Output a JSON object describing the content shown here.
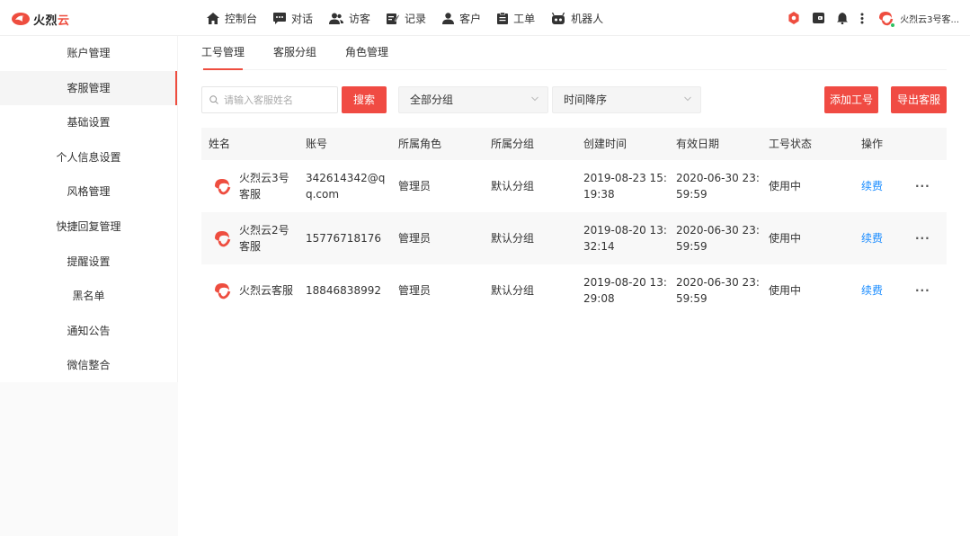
{
  "brand": {
    "name_a": "火烈",
    "name_b": "云"
  },
  "nav": [
    {
      "label": "控制台",
      "icon": "home-icon"
    },
    {
      "label": "对话",
      "icon": "chat-icon"
    },
    {
      "label": "访客",
      "icon": "visitors-icon"
    },
    {
      "label": "记录",
      "icon": "record-icon"
    },
    {
      "label": "客户",
      "icon": "customer-icon"
    },
    {
      "label": "工单",
      "icon": "ticket-icon"
    },
    {
      "label": "机器人",
      "icon": "robot-icon"
    }
  ],
  "header": {
    "user_name": "火烈云3号客..."
  },
  "sidebar": {
    "items": [
      {
        "label": "账户管理"
      },
      {
        "label": "客服管理"
      },
      {
        "label": "基础设置"
      },
      {
        "label": "个人信息设置"
      },
      {
        "label": "风格管理"
      },
      {
        "label": "快捷回复管理"
      },
      {
        "label": "提醒设置"
      },
      {
        "label": "黑名单"
      },
      {
        "label": "通知公告"
      },
      {
        "label": "微信整合"
      }
    ]
  },
  "tabs": [
    {
      "label": "工号管理"
    },
    {
      "label": "客服分组"
    },
    {
      "label": "角色管理"
    }
  ],
  "toolbar": {
    "search_placeholder": "请输入客服姓名",
    "search_button": "搜索",
    "group_select": "全部分组",
    "sort_select": "时间降序",
    "add_button": "添加工号",
    "export_button": "导出客服"
  },
  "table": {
    "headers": [
      "姓名",
      "账号",
      "所属角色",
      "所属分组",
      "创建时间",
      "有效日期",
      "工号状态",
      "操作"
    ],
    "rows": [
      {
        "name": "火烈云3号客服",
        "account": "342614342@qq.com",
        "role": "管理员",
        "group": "默认分组",
        "created": "2019-08-23 15:19:38",
        "valid": "2020-06-30 23:59:59",
        "status": "使用中",
        "action": "续费",
        "more": "···"
      },
      {
        "name": "火烈云2号客服",
        "account": "15776718176",
        "role": "管理员",
        "group": "默认分组",
        "created": "2019-08-20 13:32:14",
        "valid": "2020-06-30 23:59:59",
        "status": "使用中",
        "action": "续费",
        "more": "···"
      },
      {
        "name": "火烈云客服",
        "account": "18846838992",
        "role": "管理员",
        "group": "默认分组",
        "created": "2019-08-20 13:29:08",
        "valid": "2020-06-30 23:59:59",
        "status": "使用中",
        "action": "续费",
        "more": "···"
      }
    ]
  },
  "colors": {
    "accent": "#f04b43",
    "link": "#1a8cff",
    "online": "#2ec162"
  }
}
